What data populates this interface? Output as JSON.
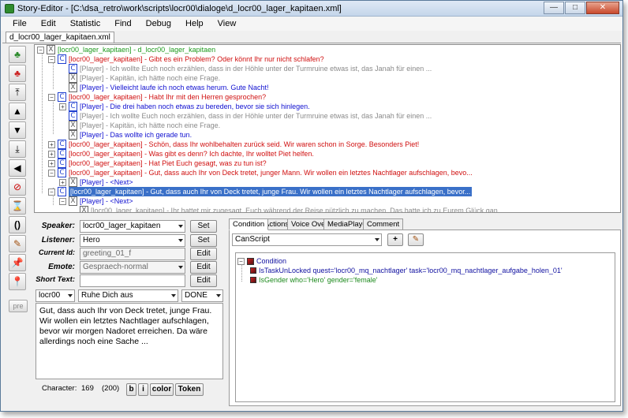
{
  "window": {
    "title": "Story-Editor - [C:\\dsa_retro\\work\\scripts\\locr00\\dialoge\\d_locr00_lager_kapitaen.xml]"
  },
  "menu": [
    "File",
    "Edit",
    "Statistic",
    "Find",
    "Debug",
    "Help",
    "View"
  ],
  "doc_tab": "d_locr00_lager_kapitaen.xml",
  "toolbar": {
    "pre_label": "pre"
  },
  "tree": {
    "root": "[locr00_lager_kapitaen] - d_locr00_lager_kapitaen",
    "rows": [
      "[locr00_lager_kapitaen] - Gibt es ein Problem? Oder könnt Ihr nur nicht schlafen?",
      "[Player] - Ich wollte Euch noch erzählen, dass in der Höhle unter der Turmruine etwas ist, das Janah für einen ...",
      "[Player] - Kapitän, ich hätte noch eine Frage.",
      "[Player] - Vielleicht laufe ich noch etwas herum. Gute Nacht!",
      "[locr00_lager_kapitaen] - Habt Ihr mit den Herren gesprochen?",
      "[Player] - Die drei haben noch etwas zu bereden, bevor sie sich hinlegen.",
      "[Player] - Ich wollte Euch noch erzählen, dass in der Höhle unter der Turmruine etwas ist, das Janah für einen ...",
      "[Player] - Kapitän, ich hätte noch eine Frage.",
      "[Player] - Das wollte ich gerade tun.",
      "[locr00_lager_kapitaen] - Schön, dass Ihr wohlbehalten zurück seid. Wir waren schon in Sorge. Besonders Piet!",
      "[locr00_lager_kapitaen] - Was gibt es denn? Ich dachte, Ihr wolltet Piet helfen.",
      "[locr00_lager_kapitaen] - Hat Piet Euch gesagt, was zu tun ist?",
      "[locr00_lager_kapitaen] - Gut, dass auch Ihr von Deck tretet, junger Mann. Wir wollen ein letztes Nachtlager aufschlagen, bevo...",
      "[Player] - <Next>",
      "[locr00_lager_kapitaen] - Gut, dass auch Ihr von Deck tretet, junge Frau. Wir wollen ein letztes Nachtlager aufschlagen, bevor...",
      "[Player] - <Next>",
      "[locr00_lager_kapitaen] - Ihr hattet mir zugesagt, Euch während der Reise nützlich zu machen. Das hatte ich zu Eurem Glück gan..."
    ]
  },
  "form": {
    "speaker_label": "Speaker:",
    "speaker_value": "locr00_lager_kapitaen",
    "listener_label": "Listener:",
    "listener_value": "Hero",
    "current_id_label": "Current Id:",
    "current_id_value": "greeting_01_f",
    "emote_label": "Emote:",
    "emote_value": "Gespraech-normal",
    "short_text_label": "Short Text:",
    "short_text_value": "",
    "set": "Set",
    "edit": "Edit",
    "scope_value": "locr00",
    "quest_value": "Ruhe Dich aus",
    "state_value": "DONE",
    "text": "Gut, dass auch Ihr von Deck tretet, junge Frau. Wir wollen ein letztes Nachtlager aufschlagen, bevor wir morgen Nadoret erreichen. Da wäre allerdings noch eine Sache ...",
    "character_label": "Character:",
    "character_count": "169",
    "character_max": "(200)",
    "bold": "b",
    "italic": "i",
    "color": "color",
    "token": "Token"
  },
  "right_tabs": [
    "Condition",
    "Actions",
    "Voice Over",
    "MediaPlayer",
    "Comment"
  ],
  "condition": {
    "script_select": "CanScript",
    "add": "+",
    "root": "Condition",
    "items": [
      "IsTaskUnLocked quest='locr00_mq_nachtlager' task='locr00_mq_nachtlager_aufgabe_holen_01'",
      "IsGender who='Hero' gender='female'"
    ]
  },
  "colors": {
    "npc": "#d01010",
    "player": "#1010d0",
    "inactive": "#8a8a8a",
    "root": "#1e9a1e",
    "selection": "#3a70c8"
  }
}
